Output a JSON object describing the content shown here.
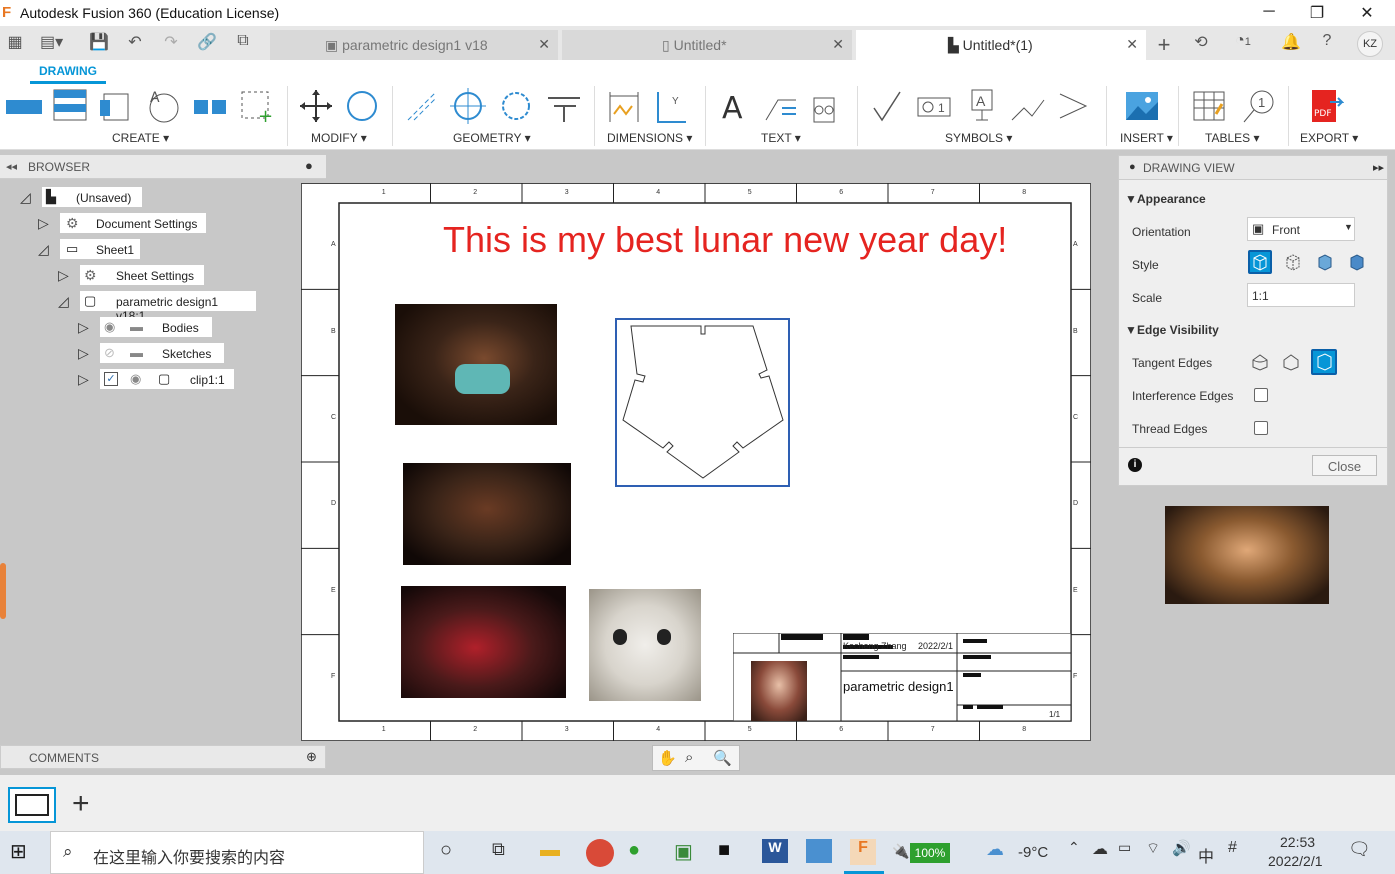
{
  "window": {
    "title": "Autodesk Fusion 360 (Education License)"
  },
  "tabs": [
    {
      "label": "parametric design1 v18",
      "active": false
    },
    {
      "label": "Untitled*",
      "active": false
    },
    {
      "label": "Untitled*(1)",
      "active": true
    }
  ],
  "header_right": {
    "jobs": "1",
    "user": "KZ"
  },
  "ribbon": {
    "tab": "DRAWING",
    "groups": [
      "CREATE ▾",
      "MODIFY ▾",
      "GEOMETRY ▾",
      "DIMENSIONS ▾",
      "TEXT ▾",
      "SYMBOLS ▾",
      "INSERT ▾",
      "TABLES ▾",
      "EXPORT ▾"
    ]
  },
  "browser": {
    "title": "BROWSER",
    "nodes": [
      {
        "label": "(Unsaved)"
      },
      {
        "label": "Document Settings"
      },
      {
        "label": "Sheet1"
      },
      {
        "label": "Sheet Settings"
      },
      {
        "label": "parametric design1 v18:1"
      },
      {
        "label": "Bodies"
      },
      {
        "label": "Sketches"
      },
      {
        "label": "clip1:1"
      }
    ]
  },
  "comments": {
    "title": "COMMENTS"
  },
  "sheet": {
    "heading": "This is my best lunar new year day!",
    "col_labels": [
      "1",
      "2",
      "3",
      "4",
      "5",
      "6",
      "7",
      "8"
    ],
    "row_labels": [
      "A",
      "B",
      "C",
      "D",
      "E",
      "F"
    ],
    "title_block": {
      "author": "Kecheng Zhang",
      "date": "2022/2/1",
      "name": "parametric design1",
      "sheet": "1/1"
    }
  },
  "drawing_view": {
    "title": "DRAWING VIEW",
    "appearance": "Appearance",
    "orientation_label": "Orientation",
    "orientation_value": "Front",
    "style_label": "Style",
    "scale_label": "Scale",
    "scale_value": "1:1",
    "edge_visibility": "Edge Visibility",
    "tangent_label": "Tangent Edges",
    "interference_label": "Interference Edges",
    "thread_label": "Thread Edges",
    "close_label": "Close"
  },
  "taskbar": {
    "search_placeholder": "在这里输入你要搜索的内容",
    "battery": "100%",
    "temperature": "-9°C",
    "ime": "中",
    "time": "22:53",
    "date": "2022/2/1"
  },
  "colors": {
    "accent": "#0696d7",
    "heading": "#e52420",
    "fusion_orange": "#e87722"
  }
}
